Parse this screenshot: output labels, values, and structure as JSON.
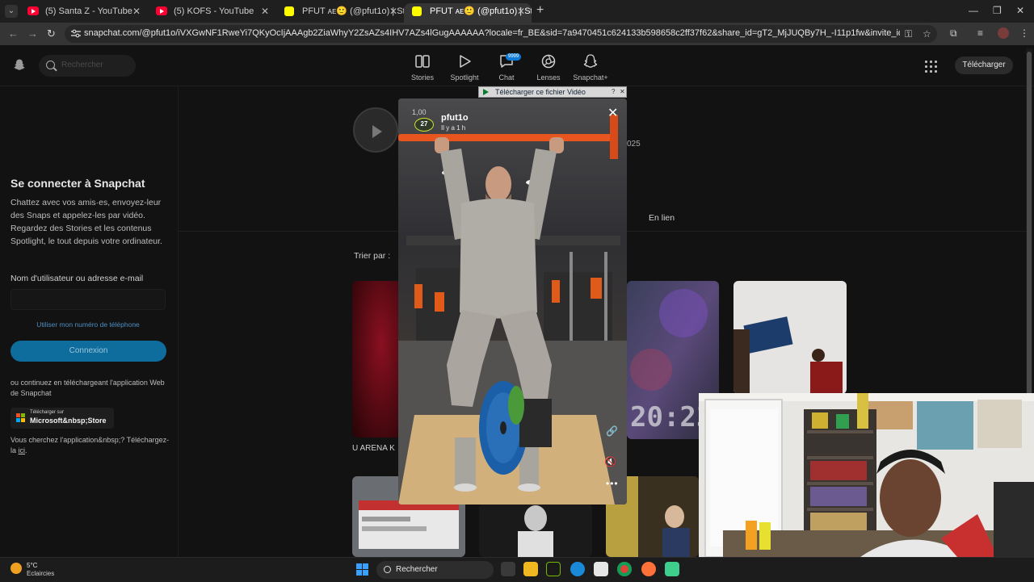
{
  "browser": {
    "tabs": [
      {
        "title": "(5) Santa Z - YouTube",
        "favicon": "youtube-icon",
        "active": false
      },
      {
        "title": "(5) KOFS - YouTube",
        "favicon": "youtube-icon",
        "active": false
      },
      {
        "title": "PFUT ᴀᴇ🙂 (@pfut1o) | Stories...",
        "favicon": "snapchat-icon",
        "active": false
      },
      {
        "title": "PFUT ᴀᴇ🙂 (@pfut1o) | Stories...",
        "favicon": "snapchat-icon",
        "active": true
      }
    ],
    "new_tab": "+",
    "url": "snapchat.com/@pfut1o/iVXGwNF1RweYi7QKyOcIjAAAgb2ZiaWhyY2ZsAZs4IHV7AZs4lGugAAAAAA?locale=fr_BE&sid=7a9470451c624133b598658c2ff37f62&share_id=gT2_MjJUQBy7H_-I11p1fw&invite_id=kbsXNfFm"
  },
  "snap_header": {
    "search_placeholder": "Rechercher",
    "nav": [
      {
        "label": "Stories",
        "icon": "stories-icon"
      },
      {
        "label": "Spotlight",
        "icon": "spotlight-play-icon"
      },
      {
        "label": "Chat",
        "icon": "chat-icon"
      },
      {
        "label": "Lenses",
        "icon": "lenses-icon"
      },
      {
        "label": "Snapchat+",
        "icon": "snapchat-plus-icon"
      }
    ],
    "chat_badge": "9999",
    "download_label": "Télécharger"
  },
  "login_panel": {
    "title": "Se connecter à Snapchat",
    "description": "Chattez avec vos amis·es, envoyez-leur des Snaps et appelez-les par vidéo. Regardez des Stories et les contenus Spotlight, le tout depuis votre ordinateur.",
    "username_label": "Nom d'utilisateur ou adresse e-mail",
    "phone_link": "Utiliser mon numéro de téléphone",
    "connect_button": "Connexion",
    "or_text": "ou continuez en téléchargeant l'application Web de Snapchat",
    "store_small": "Télécharger sur",
    "store_big": "Microsoft&nbsp;Store",
    "find_app_prefix": "Vous cherchez l'application&nbsp;? Téléchargez-la ",
    "find_app_link": "ici",
    "find_app_suffix": "."
  },
  "profile": {
    "year_fragment": "025",
    "tab_enlien": "En lien",
    "sort_label": "Trier par :",
    "thumb_label": "U ARENA K"
  },
  "story": {
    "count": "1,00",
    "avatar_number": "27",
    "username": "pfut1o",
    "time": "Il y a 1 h"
  },
  "download_video_bar": "Télécharger ce fichier Vidéo",
  "taskbar": {
    "temp": "5°C",
    "weather": "Eclaircies",
    "search_placeholder": "Rechercher"
  },
  "colors": {
    "accent_blue": "#0f6d9e",
    "snap_yellow": "#fffc00",
    "bar_orange": "#e8551f"
  }
}
